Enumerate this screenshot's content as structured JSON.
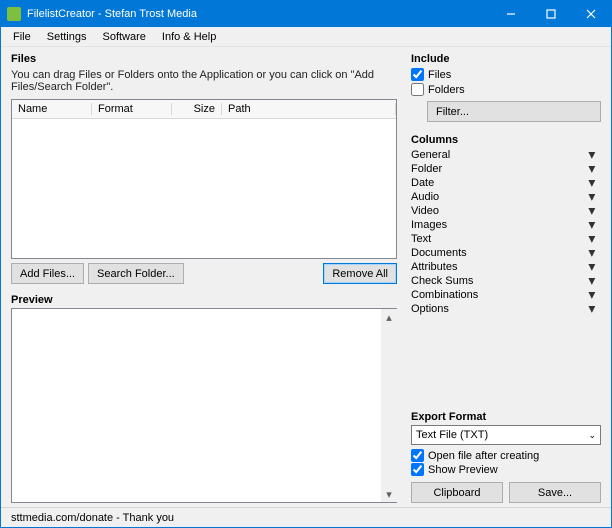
{
  "title": "FilelistCreator - Stefan Trost Media",
  "menubar": {
    "file": "File",
    "settings": "Settings",
    "software": "Software",
    "info": "Info & Help"
  },
  "files_section": {
    "heading": "Files",
    "hint": "You can drag Files or Folders onto the Application or you can click on \"Add Files/Search Folder\".",
    "headers": {
      "name": "Name",
      "format": "Format",
      "size": "Size",
      "path": "Path"
    },
    "add_files": "Add Files...",
    "search_folder": "Search Folder...",
    "remove_all": "Remove All"
  },
  "preview": {
    "heading": "Preview"
  },
  "include": {
    "heading": "Include",
    "files_label": "Files",
    "folders_label": "Folders",
    "files_checked": true,
    "folders_checked": false,
    "filter": "Filter..."
  },
  "columns": {
    "heading": "Columns",
    "items": [
      "General",
      "Folder",
      "Date",
      "Audio",
      "Video",
      "Images",
      "Text",
      "Documents",
      "Attributes",
      "Check Sums",
      "Combinations",
      "Options"
    ]
  },
  "export": {
    "heading": "Export Format",
    "selected": "Text File (TXT)",
    "open_after": "Open file after creating",
    "open_after_checked": true,
    "show_preview": "Show Preview",
    "show_preview_checked": true,
    "clipboard": "Clipboard",
    "save": "Save..."
  },
  "status": "sttmedia.com/donate - Thank you"
}
